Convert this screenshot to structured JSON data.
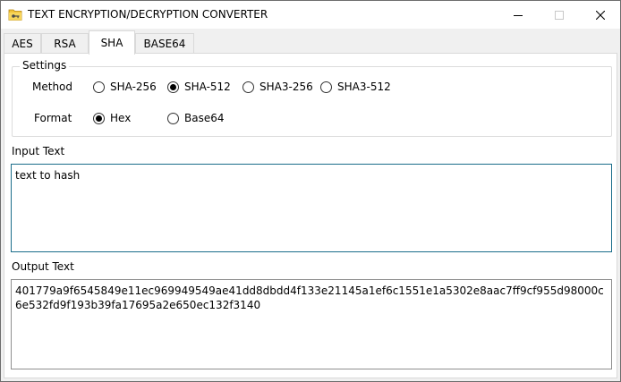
{
  "window": {
    "title": "TEXT ENCRYPTION/DECRYPTION CONVERTER",
    "icon": "folder-key-icon",
    "controls": [
      "minimize-icon",
      "maximize-icon",
      "close-icon"
    ]
  },
  "tabs": [
    {
      "label": "AES",
      "active": false
    },
    {
      "label": "RSA",
      "active": false
    },
    {
      "label": "SHA",
      "active": true
    },
    {
      "label": "BASE64",
      "active": false
    }
  ],
  "settings": {
    "group_label": "Settings",
    "method_label": "Method",
    "method_options": [
      "SHA-256",
      "SHA-512",
      "SHA3-256",
      "SHA3-512"
    ],
    "method_selected": "SHA-512",
    "format_label": "Format",
    "format_options": [
      "Hex",
      "Base64"
    ],
    "format_selected": "Hex"
  },
  "input": {
    "label": "Input Text",
    "value": "text to hash"
  },
  "output": {
    "label": "Output Text",
    "value": "401779a9f6545849e11ec969949549ae41dd8dbdd4f133e21145a1ef6c1551e1a5302e8aac7ff9cf955d98000c6e532fd9f193b39fa17695a2e650ec132f3140"
  },
  "colors": {
    "input_border": "#1a6d8a",
    "window_bg": "#f0f0f0",
    "panel_bg": "#ffffff"
  }
}
